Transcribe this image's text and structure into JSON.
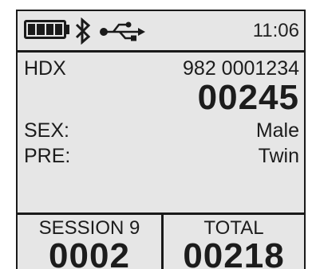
{
  "status_bar": {
    "battery_icon": "battery-full-icon",
    "bluetooth_icon": "bluetooth-icon",
    "usb_icon": "usb-icon",
    "battery_level": 1.0,
    "time": "11:06"
  },
  "reading": {
    "tag_type": "HDX",
    "tag_id": "982 0001234",
    "count": "00245",
    "fields": [
      {
        "label": "SEX:",
        "value": "Male"
      },
      {
        "label": "PRE:",
        "value": "Twin"
      }
    ]
  },
  "counters": {
    "session": {
      "label": "SESSION 9",
      "value": "0002"
    },
    "total": {
      "label": "TOTAL",
      "value": "00218"
    }
  },
  "colors": {
    "screen_background": "#e6e6e6",
    "foreground": "#1a1a1a"
  }
}
